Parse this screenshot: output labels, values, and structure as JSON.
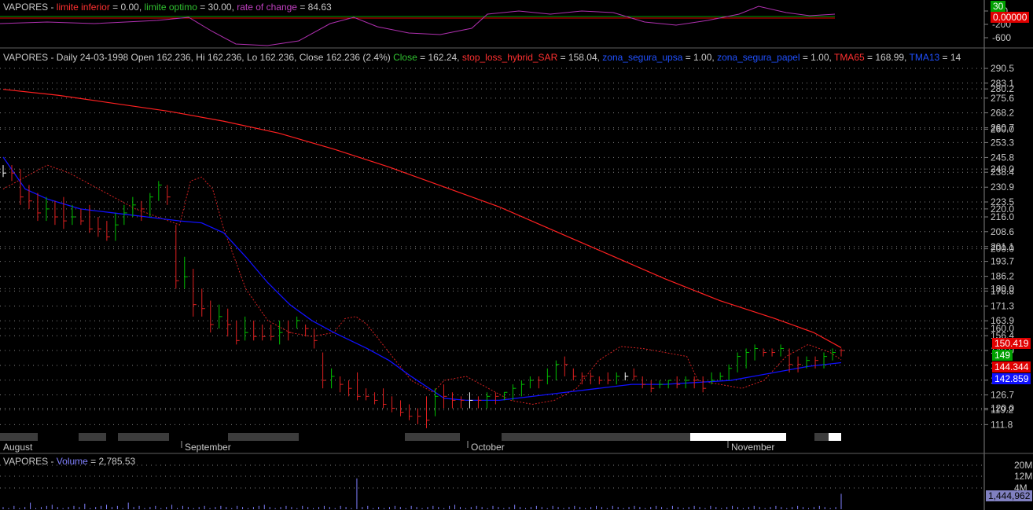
{
  "symbol": "VAPORES",
  "osc_pane": {
    "title_prefix": "VAPORES - ",
    "parts": [
      {
        "text": "limite inferior",
        "color": "#ff3030"
      },
      {
        "text": " = 0.00, ",
        "color": "#c8c8c8"
      },
      {
        "text": "limite optimo",
        "color": "#30c030"
      },
      {
        "text": " = 30.00, ",
        "color": "#c8c8c8"
      },
      {
        "text": "rate of change",
        "color": "#c040c0"
      },
      {
        "text": " = 84.63",
        "color": "#c8c8c8"
      }
    ],
    "ticks": [
      "200",
      "-200",
      "-600"
    ],
    "tags": {
      "limite_optimo": "30",
      "limite_inferior": "0.00000"
    },
    "colors": {
      "limite_optimo": "#00a000",
      "limite_inferior": "#e00000",
      "roc": "#b030b0"
    }
  },
  "price_pane": {
    "title_parts": [
      {
        "text": "VAPORES - Daily 24-03-1998 Open 162.236, Hi 162.236, Lo 162.236, Close 162.236 (2.4%) ",
        "color": "#c8c8c8"
      },
      {
        "text": "Close",
        "color": "#30c030"
      },
      {
        "text": " = 162.24, ",
        "color": "#c8c8c8"
      },
      {
        "text": "stop_loss_hybrid_SAR",
        "color": "#ff3030"
      },
      {
        "text": " = 158.04, ",
        "color": "#c8c8c8"
      },
      {
        "text": "zona_segura_upsa",
        "color": "#2050ff"
      },
      {
        "text": " = 1.00, ",
        "color": "#c8c8c8"
      },
      {
        "text": "zona_segura_papel",
        "color": "#2050ff"
      },
      {
        "text": " = 1.00, ",
        "color": "#c8c8c8"
      },
      {
        "text": "TMA65",
        "color": "#ff3030"
      },
      {
        "text": " = 168.99, ",
        "color": "#c8c8c8"
      },
      {
        "text": "TMA13",
        "color": "#2050ff"
      },
      {
        "text": " = 14",
        "color": "#c8c8c8"
      }
    ],
    "tags": {
      "tma65": "150.419",
      "close": "149",
      "sar": "144.344",
      "tma13": "142.859"
    },
    "months": [
      "August",
      "September",
      "October",
      "November"
    ]
  },
  "volume_pane": {
    "title_prefix": "VAPORES - ",
    "title_label": "Volume",
    "title_value": " = 2,785.53",
    "ticks": [
      "20M",
      "12M",
      "4M"
    ],
    "tag": "1,444,962"
  },
  "chart_data": {
    "type": "line",
    "title": "VAPORES - Daily",
    "y_ticks": [
      290.5,
      283.1,
      280.2,
      275.6,
      268.2,
      260.7,
      260.0,
      253.3,
      245.8,
      240.0,
      238.4,
      230.9,
      223.5,
      220.0,
      216.0,
      208.6,
      201.1,
      200.0,
      193.7,
      186.2,
      180.0,
      178.8,
      171.3,
      163.9,
      160.0,
      156.4,
      149.0,
      141.5,
      134.1,
      126.7,
      120.0,
      119.2,
      111.8
    ],
    "ylim": [
      108,
      298
    ],
    "bars": [
      [
        242,
        236,
        238
      ],
      [
        242,
        234,
        238
      ],
      [
        240,
        222,
        226
      ],
      [
        232,
        220,
        224
      ],
      [
        228,
        214,
        218
      ],
      [
        226,
        214,
        220
      ],
      [
        224,
        212,
        216
      ],
      [
        226,
        210,
        214
      ],
      [
        222,
        212,
        216
      ],
      [
        220,
        212,
        214
      ],
      [
        222,
        208,
        210
      ],
      [
        216,
        206,
        210
      ],
      [
        214,
        204,
        206
      ],
      [
        218,
        204,
        212
      ],
      [
        222,
        212,
        218
      ],
      [
        226,
        216,
        222
      ],
      [
        224,
        214,
        220
      ],
      [
        228,
        216,
        226
      ],
      [
        234,
        224,
        232
      ],
      [
        232,
        222,
        226
      ],
      [
        212,
        180,
        184
      ],
      [
        196,
        180,
        186
      ],
      [
        190,
        166,
        172
      ],
      [
        180,
        166,
        170
      ],
      [
        174,
        158,
        162
      ],
      [
        172,
        160,
        166
      ],
      [
        170,
        156,
        162
      ],
      [
        164,
        152,
        154
      ],
      [
        166,
        154,
        158
      ],
      [
        164,
        154,
        156
      ],
      [
        162,
        154,
        156
      ],
      [
        162,
        154,
        156
      ],
      [
        164,
        152,
        158
      ],
      [
        164,
        154,
        158
      ],
      [
        166,
        160,
        164
      ],
      [
        162,
        156,
        160
      ],
      [
        160,
        150,
        154
      ],
      [
        148,
        130,
        134
      ],
      [
        140,
        130,
        136
      ],
      [
        136,
        128,
        132
      ],
      [
        134,
        126,
        130
      ],
      [
        138,
        124,
        126
      ],
      [
        130,
        124,
        126
      ],
      [
        128,
        122,
        124
      ],
      [
        130,
        120,
        122
      ],
      [
        126,
        118,
        120
      ],
      [
        124,
        116,
        118
      ],
      [
        122,
        114,
        116
      ],
      [
        120,
        112,
        116
      ],
      [
        126,
        110,
        114
      ],
      [
        130,
        116,
        126
      ],
      [
        132,
        120,
        126
      ],
      [
        128,
        120,
        124
      ],
      [
        126,
        120,
        124
      ],
      [
        128,
        120,
        124
      ],
      [
        126,
        120,
        124
      ],
      [
        128,
        120,
        126
      ],
      [
        128,
        122,
        126
      ],
      [
        128,
        124,
        128
      ],
      [
        132,
        124,
        130
      ],
      [
        134,
        126,
        132
      ],
      [
        136,
        130,
        134
      ],
      [
        136,
        130,
        134
      ],
      [
        140,
        132,
        136
      ],
      [
        144,
        134,
        142
      ],
      [
        146,
        136,
        142
      ],
      [
        140,
        134,
        136
      ],
      [
        138,
        132,
        136
      ],
      [
        138,
        132,
        136
      ],
      [
        136,
        132,
        134
      ],
      [
        138,
        132,
        134
      ],
      [
        138,
        132,
        136
      ],
      [
        138,
        134,
        136
      ],
      [
        140,
        134,
        136
      ],
      [
        136,
        130,
        132
      ],
      [
        134,
        128,
        130
      ],
      [
        134,
        130,
        132
      ],
      [
        134,
        130,
        134
      ],
      [
        136,
        130,
        132
      ],
      [
        136,
        130,
        134
      ],
      [
        136,
        130,
        134
      ],
      [
        136,
        128,
        130
      ],
      [
        138,
        132,
        134
      ],
      [
        138,
        134,
        136
      ],
      [
        142,
        134,
        140
      ],
      [
        148,
        138,
        146
      ],
      [
        150,
        140,
        148
      ],
      [
        152,
        144,
        150
      ],
      [
        150,
        146,
        148
      ],
      [
        150,
        146,
        148
      ],
      [
        152,
        146,
        150
      ],
      [
        150,
        138,
        142
      ],
      [
        146,
        138,
        142
      ],
      [
        146,
        140,
        144
      ],
      [
        146,
        140,
        144
      ],
      [
        148,
        140,
        146
      ],
      [
        150,
        144,
        148
      ],
      [
        150,
        146,
        149
      ]
    ],
    "tma65": [
      [
        0,
        280
      ],
      [
        10,
        277
      ],
      [
        20,
        273
      ],
      [
        30,
        269
      ],
      [
        40,
        264
      ],
      [
        50,
        258
      ],
      [
        60,
        250
      ],
      [
        70,
        241
      ],
      [
        80,
        231
      ],
      [
        90,
        221
      ],
      [
        100,
        209
      ],
      [
        110,
        197
      ],
      [
        120,
        185
      ],
      [
        130,
        174
      ],
      [
        140,
        165
      ],
      [
        147,
        158
      ],
      [
        152,
        150.4
      ]
    ],
    "tma13": [
      [
        0,
        246
      ],
      [
        4,
        230
      ],
      [
        8,
        225
      ],
      [
        14,
        220
      ],
      [
        20,
        218
      ],
      [
        26,
        216
      ],
      [
        32,
        214
      ],
      [
        36,
        213
      ],
      [
        40,
        208
      ],
      [
        44,
        196
      ],
      [
        48,
        183
      ],
      [
        52,
        172
      ],
      [
        56,
        164
      ],
      [
        60,
        158
      ],
      [
        66,
        150
      ],
      [
        70,
        144
      ],
      [
        74,
        136
      ],
      [
        80,
        125
      ],
      [
        84,
        124
      ],
      [
        90,
        124
      ],
      [
        96,
        126
      ],
      [
        102,
        128
      ],
      [
        108,
        130
      ],
      [
        114,
        132
      ],
      [
        120,
        132
      ],
      [
        126,
        133
      ],
      [
        132,
        134
      ],
      [
        136,
        136
      ],
      [
        140,
        138
      ],
      [
        146,
        141
      ],
      [
        152,
        142.9
      ]
    ],
    "sar": [
      [
        0,
        230
      ],
      [
        4,
        236
      ],
      [
        8,
        242
      ],
      [
        12,
        238
      ],
      [
        16,
        232
      ],
      [
        20,
        226
      ],
      [
        24,
        220
      ],
      [
        28,
        216
      ],
      [
        32,
        212
      ],
      [
        34,
        234
      ],
      [
        36,
        236
      ],
      [
        38,
        230
      ],
      [
        40,
        210
      ],
      [
        44,
        180
      ],
      [
        48,
        164
      ],
      [
        52,
        158
      ],
      [
        56,
        156
      ],
      [
        60,
        158
      ],
      [
        62,
        165
      ],
      [
        64,
        166
      ],
      [
        66,
        162
      ],
      [
        70,
        148
      ],
      [
        74,
        134
      ],
      [
        78,
        128
      ],
      [
        80,
        134
      ],
      [
        84,
        136
      ],
      [
        88,
        130
      ],
      [
        92,
        124
      ],
      [
        96,
        122
      ],
      [
        100,
        124
      ],
      [
        104,
        130
      ],
      [
        108,
        144
      ],
      [
        112,
        151
      ],
      [
        116,
        150
      ],
      [
        120,
        148
      ],
      [
        124,
        146
      ],
      [
        126,
        134
      ],
      [
        130,
        132
      ],
      [
        134,
        130
      ],
      [
        138,
        134
      ],
      [
        142,
        146
      ],
      [
        146,
        152
      ],
      [
        150,
        148
      ],
      [
        152,
        144.3
      ]
    ],
    "volume": [
      0.2,
      0.1,
      0.3,
      0.1,
      0.2,
      0.6,
      0.1,
      0.2,
      0.3,
      0.4,
      0.2,
      0.1,
      0.2,
      0.3,
      0.2,
      0.5,
      0.1,
      0.2,
      0.3,
      0.4,
      0.2,
      0.3,
      0.1,
      0.6,
      0.2,
      0.3,
      0.1,
      0.2,
      0.3,
      0.1,
      0.2,
      0.4,
      0.1,
      0.3,
      0.2,
      0.1,
      0.2,
      0.3,
      0.1,
      0.2,
      0.3,
      0.2,
      0.1,
      0.3,
      0.2,
      0.1,
      0.2,
      0.3,
      0.4,
      0.2,
      0.1,
      0.2,
      0.3,
      0.2,
      0.1,
      0.3,
      0.2,
      0.1,
      0.2,
      0.3,
      0.2,
      0.1,
      0.3,
      0.2,
      0.1,
      2.8,
      0.2,
      0.3,
      0.1,
      0.2,
      0.1,
      0.2,
      0.3,
      0.2,
      0.1,
      0.3,
      0.2,
      0.1,
      0.2,
      0.3,
      0.2,
      0.1,
      0.3,
      0.4,
      0.2,
      0.1,
      0.2,
      0.3,
      0.2,
      0.1,
      0.3,
      0.2,
      0.1,
      0.2,
      0.4,
      0.2,
      0.1,
      0.2,
      0.3,
      0.2,
      0.1,
      0.3,
      0.2,
      0.1,
      0.2,
      0.3,
      0.2,
      0.1,
      0.2,
      0.3,
      0.2,
      0.1,
      0.3,
      0.2,
      0.1,
      0.2,
      0.3,
      0.2,
      0.1,
      0.2,
      0.3,
      0.2,
      0.1,
      0.3,
      0.2,
      0.1,
      0.2,
      0.3,
      0.2,
      0.1,
      0.3,
      0.2,
      0.1,
      0.2,
      0.3,
      0.2,
      0.1,
      0.2,
      0.3,
      0.2,
      0.1,
      0.2,
      0.3,
      0.2,
      0.1,
      0.2,
      0.3,
      0.2,
      0.1,
      0.2,
      0.3,
      0.2,
      0.1,
      0.2,
      1.4
    ],
    "volume_unit": "M"
  },
  "colors": {
    "up": "#00c000",
    "down": "#e02020",
    "neutral": "#ffffff",
    "tma65": "#ff2020",
    "tma13": "#1010ff",
    "sar": "#d02020",
    "volume": "#8080ff"
  }
}
